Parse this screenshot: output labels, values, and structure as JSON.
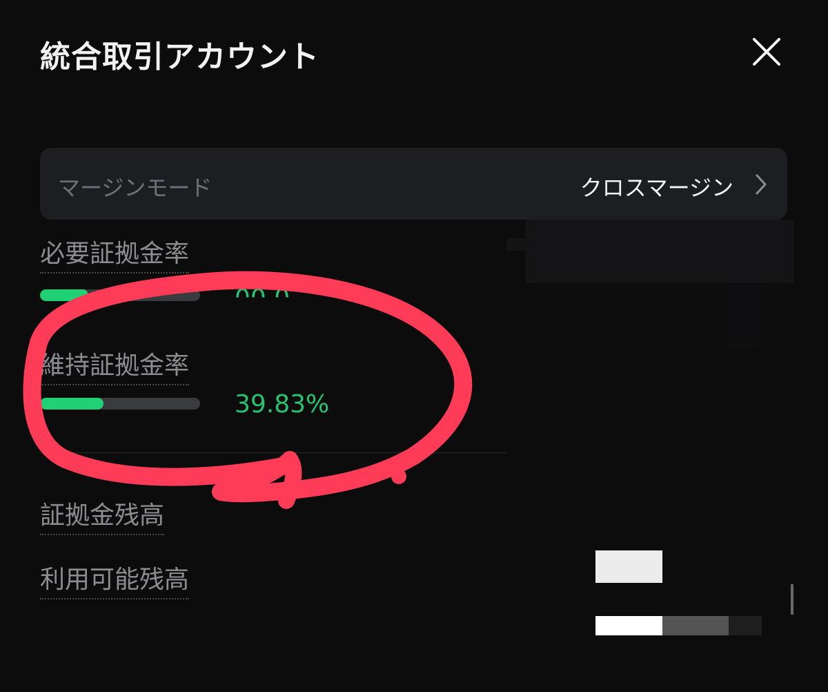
{
  "header": {
    "title": "統合取引アカウント",
    "close_icon": "close-icon"
  },
  "margin_mode": {
    "label": "マージンモード",
    "value": "クロスマージン",
    "chevron_icon": "chevron-right-icon"
  },
  "metrics": {
    "initial_margin": {
      "label": "必要証拠金率",
      "value_partial": "00.0"
    },
    "maintenance_margin": {
      "label": "維持証拠金率",
      "value": "39.83%",
      "progress": 0.3983
    },
    "margin_balance": {
      "label": "証拠金残高"
    },
    "available_balance": {
      "label": "利用可能残高"
    }
  },
  "colors": {
    "background": "#0c0c0d",
    "panel": "#1d1e22",
    "accent_green": "#1fd174",
    "annotation_red": "#ff3c57"
  }
}
